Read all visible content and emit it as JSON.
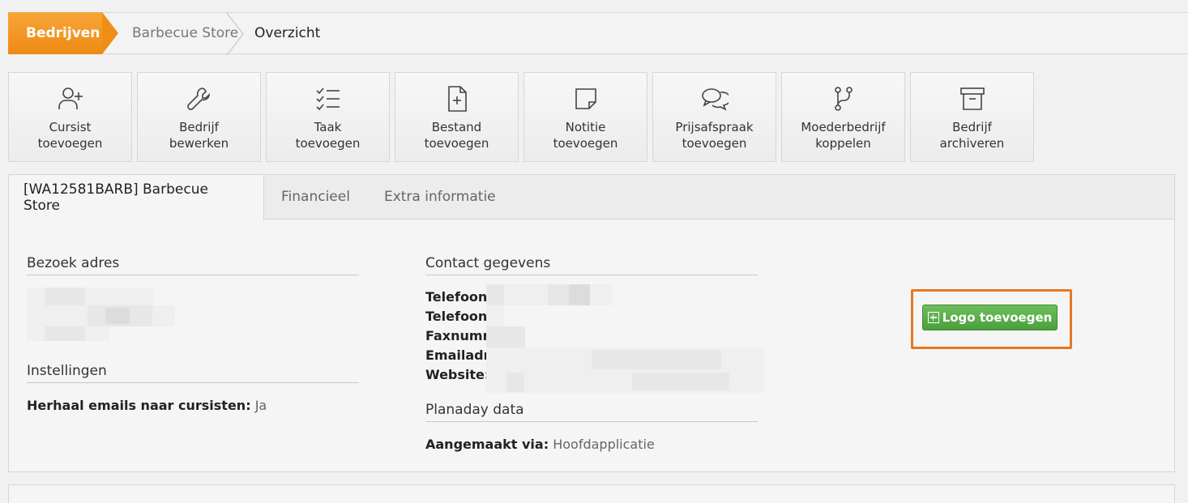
{
  "breadcrumb": {
    "items": [
      "Bedrijven",
      "Barbecue Store",
      "Overzicht"
    ]
  },
  "toolbar": [
    {
      "icon": "user-plus-icon",
      "label": "Cursist\ntoevoegen"
    },
    {
      "icon": "wrench-icon",
      "label": "Bedrijf\nbewerken"
    },
    {
      "icon": "checklist-icon",
      "label": "Taak\ntoevoegen"
    },
    {
      "icon": "file-plus-icon",
      "label": "Bestand\ntoevoegen"
    },
    {
      "icon": "sticky-note-icon",
      "label": "Notitie\ntoevoegen"
    },
    {
      "icon": "chat-bubbles-icon",
      "label": "Prijsafspraak\ntoevoegen"
    },
    {
      "icon": "branch-icon",
      "label": "Moederbedrijf\nkoppelen"
    },
    {
      "icon": "archive-icon",
      "label": "Bedrijf\narchiveren"
    }
  ],
  "tabs": [
    "[WA12581BARB] Barbecue Store",
    "Financieel",
    "Extra informatie"
  ],
  "address": {
    "title": "Bezoek adres"
  },
  "settings": {
    "title": "Instellingen",
    "email_label": "Herhaal emails naar cursisten:",
    "email_value": "Ja"
  },
  "contact": {
    "title": "Contact gegevens",
    "labels": [
      "Telefoon",
      "Telefoon",
      "Faxnumm",
      "Emailadr",
      "Website:"
    ]
  },
  "planaday": {
    "title": "Planaday data",
    "created_label": "Aangemaakt via:",
    "created_value": "Hoofdapplicatie"
  },
  "logo_button": "Logo toevoegen",
  "colors": {
    "accent_orange": "#ee8a12",
    "highlight_frame": "#e87722",
    "button_green": "#5aaf4a"
  }
}
